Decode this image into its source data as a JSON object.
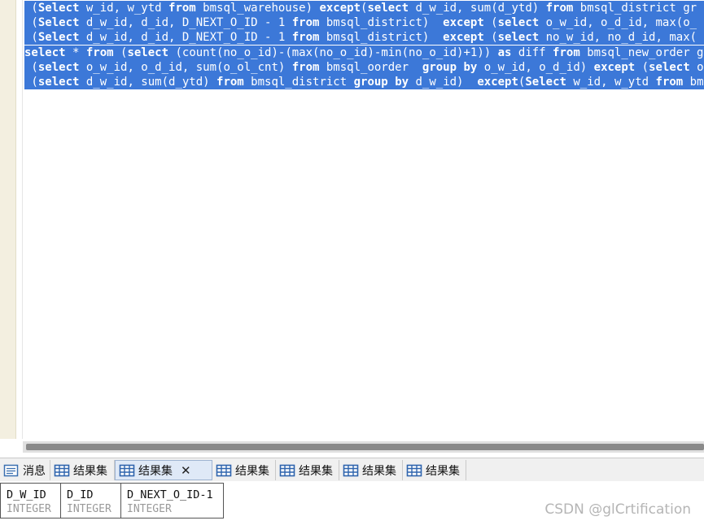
{
  "editor": {
    "lines": [
      " (Select w_id, w_ytd from bmsql_warehouse) except(select d_w_id, sum(d_ytd) from bmsql_district gr",
      " (Select d_w_id, d_id, D_NEXT_O_ID - 1 from bmsql_district)  except (select o_w_id, o_d_id, max(o_",
      " (Select d_w_id, d_id, D_NEXT_O_ID - 1 from bmsql_district)  except (select no_w_id, no_d_id, max(",
      "select * from (select (count(no_o_id)-(max(no_o_id)-min(no_o_id)+1)) as diff from bmsql_new_order g",
      " (select o_w_id, o_d_id, sum(o_ol_cnt) from bmsql_oorder  group by o_w_id, o_d_id) except (select o",
      " (select d_w_id, sum(d_ytd) from bmsql_district group by d_w_id)  except(Select w_id, w_ytd from bm"
    ]
  },
  "tabs": [
    {
      "label": "消息",
      "icon": "message-icon"
    },
    {
      "label": "结果集",
      "icon": "table-icon"
    },
    {
      "label": "结果集",
      "icon": "table-icon",
      "active": true
    },
    {
      "label": "结果集",
      "icon": "table-icon"
    },
    {
      "label": "结果集",
      "icon": "table-icon"
    },
    {
      "label": "结果集",
      "icon": "table-icon"
    },
    {
      "label": "结果集",
      "icon": "table-icon"
    }
  ],
  "result": {
    "columns": [
      {
        "name": "D_W_ID",
        "type": "INTEGER"
      },
      {
        "name": "D_ID",
        "type": "INTEGER"
      },
      {
        "name": "D_NEXT_O_ID-1",
        "type": "INTEGER"
      }
    ]
  },
  "watermark": "CSDN @glCrtification",
  "colors": {
    "selection": "#3c78d8",
    "gutter": "#f3efe0"
  }
}
